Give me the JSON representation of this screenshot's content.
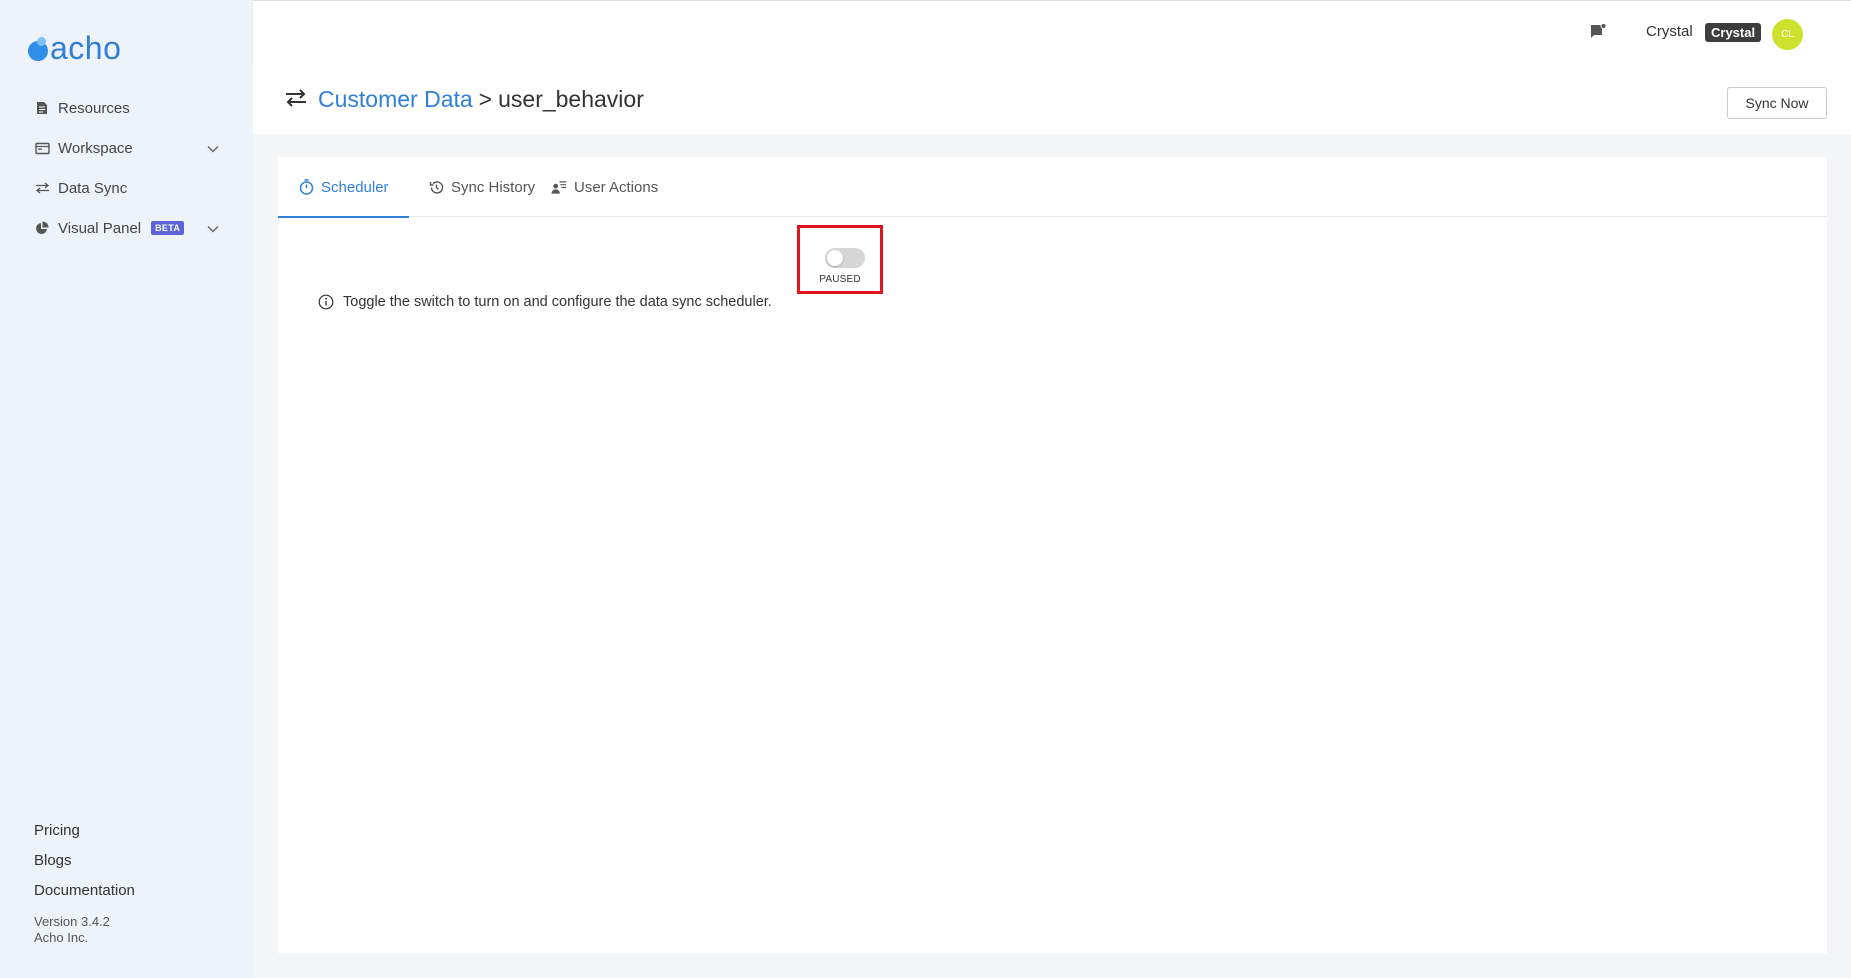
{
  "brand": {
    "logo_text": "acho"
  },
  "sidebar": {
    "items": [
      {
        "label": "Resources",
        "icon": "document-icon",
        "has_chevron": false
      },
      {
        "label": "Workspace",
        "icon": "folder-icon",
        "has_chevron": true
      },
      {
        "label": "Data Sync",
        "icon": "sync-arrows-icon",
        "has_chevron": false
      },
      {
        "label": "Visual Panel",
        "icon": "pie-chart-icon",
        "has_chevron": true,
        "badge": "BETA"
      }
    ],
    "bottom_links": [
      "Pricing",
      "Blogs",
      "Documentation"
    ],
    "version": "Version 3.4.2",
    "company": "Acho Inc."
  },
  "header": {
    "username": "Crystal",
    "user_badge": "Crystal",
    "avatar_initials": "CL",
    "avatar_color": "#cde22e"
  },
  "page": {
    "breadcrumb_parent": "Customer Data",
    "breadcrumb_separator": ">",
    "breadcrumb_current": "user_behavior",
    "sync_now_label": "Sync Now"
  },
  "tabs": [
    {
      "label": "Scheduler",
      "icon": "stopwatch-icon",
      "active": true
    },
    {
      "label": "Sync History",
      "icon": "history-icon",
      "active": false
    },
    {
      "label": "User Actions",
      "icon": "user-list-icon",
      "active": false
    }
  ],
  "scheduler": {
    "toggle_state": "off",
    "toggle_label": "PAUSED",
    "info_text": "Toggle the switch to turn on and configure the data sync scheduler."
  },
  "colors": {
    "accent": "#2f7fd9",
    "highlight_border": "#e0141e",
    "beta_badge": "#5b64d9"
  }
}
